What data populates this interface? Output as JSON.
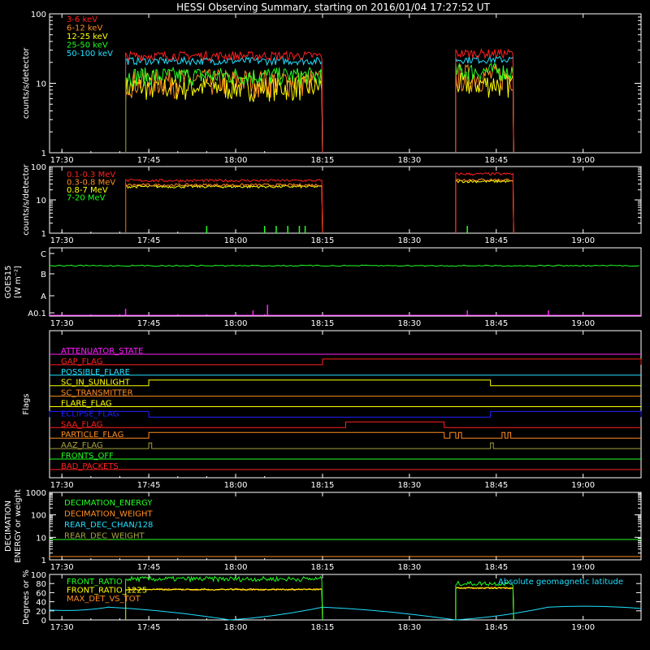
{
  "title": "HESSI Observing Summary, starting on 2016/01/04 17:27:52 UT",
  "time_ticks": [
    "17:30",
    "17:45",
    "18:00",
    "18:15",
    "18:30",
    "18:45",
    "19:00"
  ],
  "colors": {
    "red": "#ff2020",
    "orange": "#ff8c20",
    "yellow": "#ffff00",
    "green": "#20ff20",
    "cyan": "#20e0ff",
    "magenta": "#ff20ff",
    "blue": "#2020ff",
    "olive": "#a8a040",
    "white": "#ffffff"
  },
  "chart_data": [
    {
      "type": "line",
      "name": "low-energy",
      "ylabel": "counts/s/detector",
      "yscale": "log",
      "ylim": [
        1,
        100
      ],
      "ytick_labels": [
        "1",
        "10",
        "100"
      ],
      "xlim": [
        "17:27:52",
        "19:10"
      ],
      "intervals": [
        [
          "17:41",
          "18:15"
        ],
        [
          "18:38",
          "18:48"
        ]
      ],
      "series": [
        {
          "name": "3-6 keV",
          "color": "red",
          "values": [
            25,
            27
          ]
        },
        {
          "name": "6-12 keV",
          "color": "orange",
          "values": [
            11,
            13
          ]
        },
        {
          "name": "12-25 keV",
          "color": "yellow",
          "values": [
            9,
            10
          ]
        },
        {
          "name": "25-50 keV",
          "color": "green",
          "values": [
            13,
            15
          ]
        },
        {
          "name": "50-100 keV",
          "color": "cyan",
          "values": [
            21,
            22
          ]
        }
      ]
    },
    {
      "type": "line",
      "name": "high-energy",
      "ylabel": "counts/s/detector",
      "yscale": "log",
      "ylim": [
        1,
        100
      ],
      "ytick_labels": [
        "1",
        "10",
        "100"
      ],
      "intervals": [
        [
          "17:41",
          "18:15"
        ],
        [
          "18:38",
          "18:48"
        ]
      ],
      "series": [
        {
          "name": "0.1-0.3 MeV",
          "color": "red",
          "values": [
            38,
            60
          ]
        },
        {
          "name": "0.3-0.8 MeV",
          "color": "orange",
          "values": [
            28,
            40
          ]
        },
        {
          "name": "0.8-7 MeV",
          "color": "yellow",
          "values": [
            25,
            36
          ]
        },
        {
          "name": "7-20 MeV",
          "color": "green",
          "values": [
            1,
            1
          ]
        }
      ]
    },
    {
      "type": "line",
      "name": "goes",
      "ylabel": "GOES15",
      "ylabel2": "[W m⁻²]",
      "ytick_labels": [
        "A0.1",
        "A",
        "B",
        "C"
      ],
      "series": [
        {
          "name": "goes-long",
          "color": "green",
          "value_level": "B+0.5"
        },
        {
          "name": "goes-short",
          "color": "magenta",
          "value_level": "A0.1"
        }
      ]
    },
    {
      "type": "table",
      "name": "flags",
      "ylabel": "Flags",
      "flags": [
        {
          "name": "ATTENUATOR_STATE",
          "color": "magenta",
          "steps": []
        },
        {
          "name": "GAP_FLAG",
          "color": "red",
          "steps": [
            [
              "18:15",
              "19:10"
            ]
          ]
        },
        {
          "name": "POSSIBLE_FLARE",
          "color": "cyan",
          "steps": []
        },
        {
          "name": "SC_IN_SUNLIGHT",
          "color": "yellow",
          "steps": [
            [
              "17:45",
              "18:44"
            ]
          ]
        },
        {
          "name": "SC_TRANSMITTER",
          "color": "orange",
          "steps": []
        },
        {
          "name": "FLARE_FLAG",
          "color": "yellow",
          "steps": []
        },
        {
          "name": "ECLIPSE_FLAG",
          "color": "blue",
          "steps": [
            [
              "17:27:52",
              "17:45"
            ],
            [
              "18:44",
              "19:10"
            ]
          ]
        },
        {
          "name": "SAA_FLAG",
          "color": "red",
          "steps": [
            [
              "18:19",
              "18:36"
            ]
          ]
        },
        {
          "name": "PARTICLE_FLAG",
          "color": "orange",
          "steps": [
            [
              "17:45",
              "18:36"
            ],
            [
              "18:37",
              "18:38"
            ],
            [
              "18:38:30",
              "18:39"
            ],
            [
              "18:46",
              "18:46:30"
            ],
            [
              "18:47",
              "18:47:30"
            ]
          ]
        },
        {
          "name": "AAZ_FLAG",
          "color": "olive",
          "steps": [
            [
              "17:45",
              "17:45:30"
            ],
            [
              "18:44",
              "18:44:30"
            ]
          ]
        },
        {
          "name": "FRONTS_OFF",
          "color": "green",
          "steps": []
        },
        {
          "name": "BAD_PACKETS",
          "color": "red",
          "steps": []
        }
      ]
    },
    {
      "type": "line",
      "name": "decimation",
      "ylabel": "DECIMATION",
      "ylabel2": "ENERGY or weight",
      "yscale": "log",
      "ylim": [
        1,
        1000
      ],
      "ytick_labels": [
        "1",
        "10",
        "100",
        "1000"
      ],
      "series": [
        {
          "name": "DECIMATION_ENERGY",
          "color": "green",
          "values": [
            8
          ]
        },
        {
          "name": "DECIMATION_WEIGHT",
          "color": "orange",
          "values": [
            1.4
          ]
        },
        {
          "name": "REAR_DEC_CHAN/128",
          "color": "cyan",
          "values": []
        },
        {
          "name": "REAR_DEC_WEIGHT",
          "color": "olive",
          "values": []
        }
      ]
    },
    {
      "type": "line",
      "name": "ratios",
      "ylabel": "Degrees or %",
      "ylim": [
        0,
        100
      ],
      "ytick_labels": [
        "0",
        "20",
        "40",
        "60",
        "80",
        "100"
      ],
      "annotation": "Absolute geomagnetic latitude",
      "intervals": [
        [
          "17:41",
          "18:15"
        ],
        [
          "18:38",
          "18:48"
        ]
      ],
      "series": [
        {
          "name": "FRONT_RATIO",
          "color": "green",
          "values": [
            90,
            80
          ]
        },
        {
          "name": "FRONT_RATIO_1225",
          "color": "yellow",
          "values": [
            67,
            70
          ]
        },
        {
          "name": "MAX_DET_VS_TOT",
          "color": "orange",
          "values": [
            67,
            70
          ]
        },
        {
          "name": "Absolute geomagnetic latitude",
          "color": "cyan",
          "latitude_points": [
            [
              "17:27:52",
              22
            ],
            [
              "17:38",
              28
            ],
            [
              "17:59",
              0
            ],
            [
              "18:15",
              28
            ],
            [
              "18:38",
              0
            ],
            [
              "18:54",
              28
            ],
            [
              "19:10",
              25
            ]
          ]
        }
      ]
    }
  ]
}
